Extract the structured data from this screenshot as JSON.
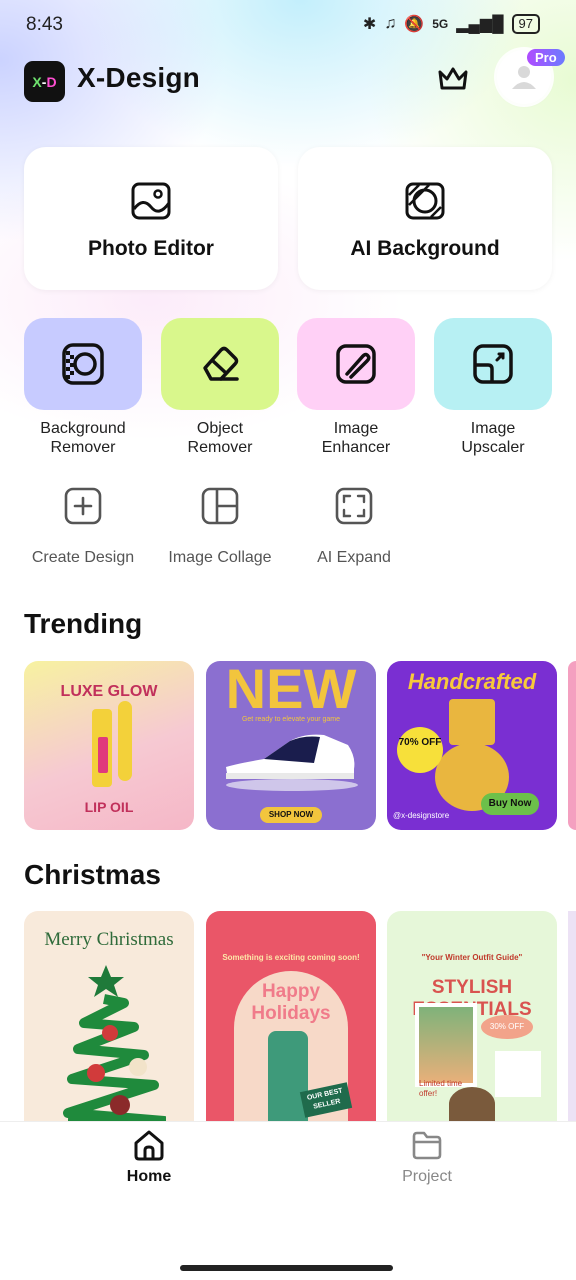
{
  "status": {
    "time": "8:43",
    "network": "5G",
    "battery": "97"
  },
  "header": {
    "logo_text_x": "X",
    "logo_text_d": "D",
    "title": "X-Design",
    "pro_badge": "Pro"
  },
  "main_cards": [
    {
      "label": "Photo Editor",
      "icon": "image-icon"
    },
    {
      "label": "AI Background",
      "icon": "ai-background-icon"
    }
  ],
  "tools": [
    {
      "label_line1": "Background",
      "label_line2": "Remover",
      "color": "#c7cbff",
      "icon": "background-remover-icon"
    },
    {
      "label_line1": "Object",
      "label_line2": "Remover",
      "color": "#d9f78c",
      "icon": "eraser-icon"
    },
    {
      "label_line1": "Image",
      "label_line2": "Enhancer",
      "color": "#ffd0f6",
      "icon": "enhancer-icon"
    },
    {
      "label_line1": "Image",
      "label_line2": "Upscaler",
      "color": "#b7f0f3",
      "icon": "upscaler-icon"
    }
  ],
  "mini_tools": [
    {
      "label": "Create Design",
      "icon": "plus-square-icon"
    },
    {
      "label": "Image Collage",
      "icon": "collage-icon"
    },
    {
      "label": "AI Expand",
      "icon": "expand-icon"
    }
  ],
  "trending": {
    "title": "Trending",
    "items": [
      {
        "text1": "LUXE GLOW",
        "text2": "LIP OIL"
      },
      {
        "text1": "NEW",
        "text2": "Get ready to elevate your game",
        "button": "SHOP NOW"
      },
      {
        "text1": "Handcrafted",
        "badge": "70% OFF",
        "handle": "@x-designstore",
        "button": "Buy Now"
      }
    ]
  },
  "christmas": {
    "title": "Christmas",
    "items": [
      {
        "text1": "Merry Christmas"
      },
      {
        "text1": "Something is exciting coming soon!",
        "text2": "Happy Holidays",
        "badge": "OUR BEST SELLER"
      },
      {
        "text1": "\"Your Winter Outfit Guide\"",
        "text2": "STYLISH ESSENTIALS",
        "badge": "30% OFF",
        "note": "Limited time offer!"
      }
    ]
  },
  "nav": {
    "home": "Home",
    "project": "Project"
  }
}
